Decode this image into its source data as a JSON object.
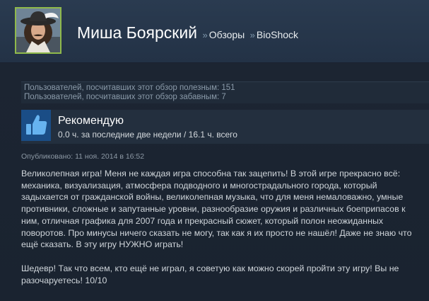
{
  "profile": {
    "name": "Миша Боярский",
    "breadcrumb": [
      {
        "sep": "»",
        "label": "Обзоры"
      },
      {
        "sep": "»",
        "label": "BioShock"
      }
    ]
  },
  "helpful": {
    "line1": "Пользователей, посчитавших этот обзор полезным: 151",
    "line2": "Пользователей, посчитавших этот обзор забавным: 7"
  },
  "recommendation": {
    "title": "Рекомендую",
    "hours": "0.0 ч. за последние две недели / 16.1 ч. всего"
  },
  "posted": "Опубликовано: 11 ноя. 2014 в 16:52",
  "review": {
    "paragraph1": "Великолепная игра! Меня не каждая игра способна так зацепить! В этой игре прекрасно всё: механика, визуализация, атмосфера подводного и многострадального города, который задыхается от гражданской войны, великолепная музыка, что для меня немаловажно, умные противники, сложные и запутанные уровни, разнообразие оружия и различных боеприпасов к ним, отличная графика для 2007 года и прекрасный сюжет, который полон неожиданных поворотов. Про минусы ничего сказать не могу, так как я их просто не нашёл! Даже не знаю что ещё сказать. В эту игру НУЖНО играть!",
    "paragraph2": "Шедевр! Так что всем, кто ещё не играл, я советую как можно скорей пройти эту игру! Вы не разочаруетесь! 10/10"
  },
  "icons": {
    "avatar": "avatar-portrait",
    "thumb": "thumbs-up-icon"
  },
  "colors": {
    "avatar_border": "#8fb94b",
    "thumb_bg": "#1a4d86",
    "thumb": "#66b3f0"
  }
}
